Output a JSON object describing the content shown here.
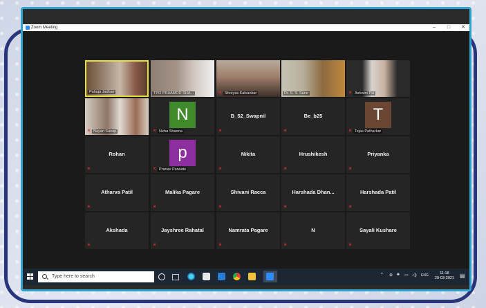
{
  "window": {
    "title": "Zoom Meeting",
    "minimize_glyph": "–",
    "restore_glyph": "□",
    "close_glyph": "✕"
  },
  "participants": {
    "video": [
      {
        "name": "Pahuja Jadhav",
        "active": true
      },
      {
        "name": "TPO PRAAMOD SHA..."
      },
      {
        "name": "Shreyas Kalvankar"
      },
      {
        "name": "Dr. S. S. Sane"
      },
      {
        "name": "Ashwini Pal"
      },
      {
        "name": "Nayan Sanap"
      }
    ],
    "avatar": [
      {
        "initial": "N",
        "name": "Neha Sharma",
        "color": "#3f8a2a"
      },
      {
        "initial": "T",
        "name": "Tejas Patharkar",
        "color": "#6b4633"
      },
      {
        "initial": "p",
        "name": "Pranav Parwate",
        "color": "#8e2fa0"
      }
    ],
    "names": [
      "B_52_Swapnil",
      "Be_b25",
      "Rohan",
      "Nikita",
      "Hrushikesh",
      "Priyanka",
      "Atharva Patil",
      "Malika Pagare",
      "Shivani Racca",
      "Harshada  Dhan...",
      "Harshada Patil",
      "Akshada",
      "Jayshree Rahatal",
      "Namrata Pagare",
      "N",
      "Sayali Kushare"
    ]
  },
  "taskbar": {
    "search_placeholder": "Type here to search",
    "lang": "ENG",
    "time": "11:18",
    "date": "20-03-2021",
    "icon_names": [
      "cortana-icon",
      "task-view-icon",
      "edge-icon",
      "store-icon",
      "mail-icon",
      "chrome-icon",
      "file-explorer-icon",
      "zoom-icon"
    ]
  },
  "colors": {
    "frame_blue": "#28357a",
    "monitor_border": "#2fa3d0",
    "active_speaker": "#e7e13e",
    "mute_red": "#e03030"
  }
}
